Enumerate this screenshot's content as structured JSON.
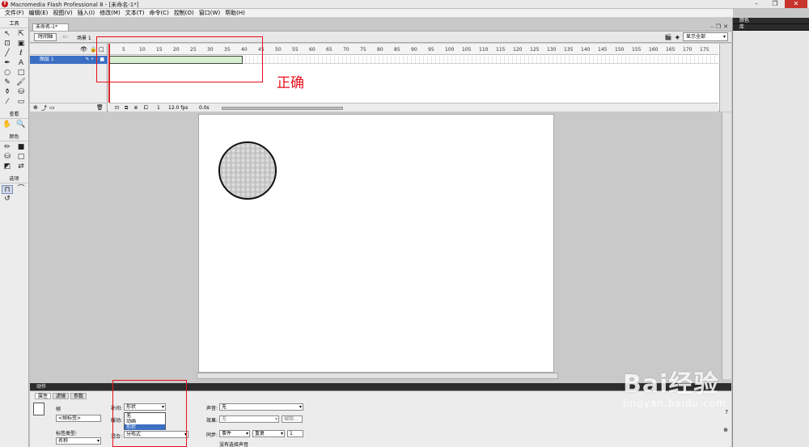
{
  "window": {
    "title": "Macromedia Flash Professional 8 - [未命名-1*]"
  },
  "menu": [
    "文件(F)",
    "编辑(E)",
    "视图(V)",
    "插入(I)",
    "修改(M)",
    "文本(T)",
    "命令(C)",
    "控制(O)",
    "窗口(W)",
    "帮助(H)"
  ],
  "toolbox": {
    "tools_label": "工具",
    "view_label": "查看",
    "colors_label": "颜色",
    "options_label": "选项"
  },
  "document": {
    "tab_label": "未命名-1*"
  },
  "timeline_bar": {
    "timeline_button": "时间轴",
    "scene_label": "场景 1",
    "zoom_value": "显示全部"
  },
  "timeline": {
    "layer_name": "图层 1",
    "ruler_ticks": [
      "5",
      "10",
      "15",
      "20",
      "25",
      "30",
      "35",
      "40",
      "45",
      "50",
      "55",
      "60",
      "65",
      "70",
      "75",
      "80",
      "85",
      "90",
      "95",
      "100",
      "105",
      "110",
      "115",
      "120",
      "125",
      "130",
      "135",
      "140",
      "145",
      "150",
      "155",
      "160",
      "165",
      "170",
      "175"
    ],
    "current_frame": "1",
    "frame_rate": "12.0 fps",
    "elapsed": "0.0s"
  },
  "annotation": {
    "label": "正确",
    "color": "#e8101c"
  },
  "panels": {
    "actions_header": "动作",
    "properties_tabs": [
      "属性",
      "滤镜",
      "参数"
    ],
    "frame_label": "帧",
    "frame_label_placeholder": "<帧标签>",
    "label_type_label": "标签类型:",
    "label_type_value": "名称",
    "tween_label": "补间:",
    "tween_value": "形状",
    "tween_options": [
      "无",
      "动画",
      "形状"
    ],
    "ease_label": "缓动:",
    "blend_label": "混合:",
    "blend_value": "分布式",
    "sound_label": "声音:",
    "sound_value": "无",
    "effect_label": "效果:",
    "effect_value": "无",
    "edit_button": "编辑...",
    "sync_label": "同步:",
    "sync_value": "事件",
    "repeat_value": "重复",
    "repeat_count": "1",
    "no_sound_text": "没有选择声音",
    "color_panel": "颜色",
    "library_panel": "库"
  },
  "watermark": {
    "logo": "Bai经验",
    "url": "jingyan.baidu.com"
  }
}
